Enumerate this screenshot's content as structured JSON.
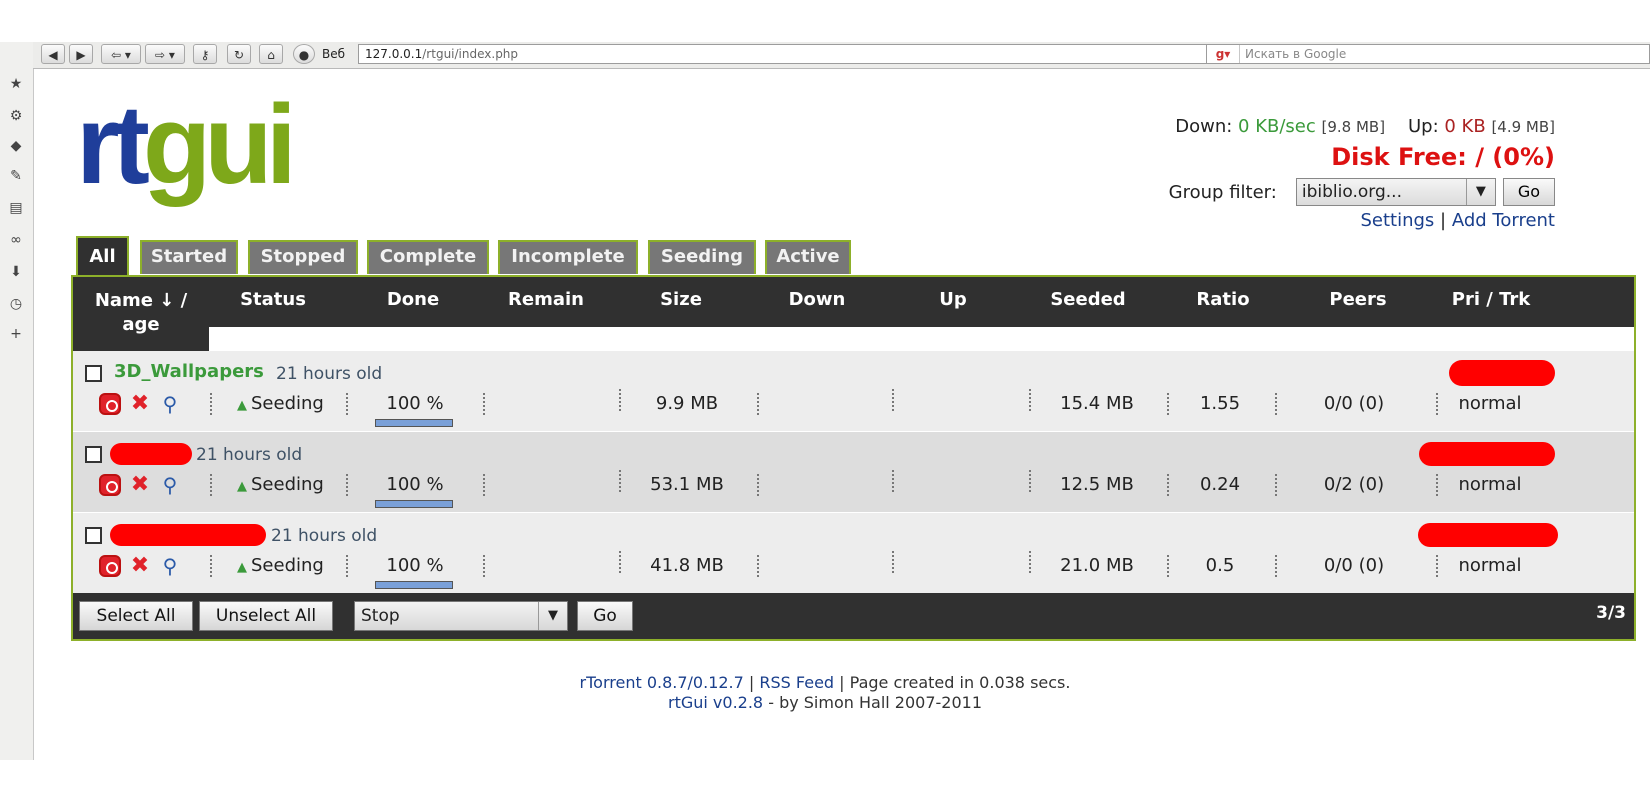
{
  "browser": {
    "web_label": "Веб",
    "url_host": "127.0.0.1",
    "url_path": "/rtgui/index.php",
    "search_placeholder": "Искать в Google"
  },
  "logo": {
    "part1": "rt",
    "part2": "gui"
  },
  "header": {
    "down_label": "Down:",
    "down_rate": "0 KB/sec",
    "down_total": "[9.8 MB]",
    "up_label": "Up:",
    "up_rate": "0 KB",
    "up_total": "[4.9 MB]",
    "disk_free": "Disk Free: / (0%)",
    "group_filter_label": "Group filter:",
    "group_filter_value": "ibiblio.org...",
    "go_label": "Go",
    "settings_label": "Settings",
    "separator": "|",
    "add_torrent_label": "Add Torrent"
  },
  "tabs": [
    "All",
    "Started",
    "Stopped",
    "Complete",
    "Incomplete",
    "Seeding",
    "Active"
  ],
  "columns": {
    "name": "Name ↓ /",
    "name2": "age",
    "status": "Status",
    "done": "Done",
    "remain": "Remain",
    "size": "Size",
    "down": "Down",
    "up": "Up",
    "seeded": "Seeded",
    "ratio": "Ratio",
    "peers": "Peers",
    "pri_trk": "Pri / Trk"
  },
  "torrents": [
    {
      "name": "3D_Wallpapers",
      "age": "21 hours old",
      "status": "Seeding",
      "done": "100 %",
      "done_fraction": 1.0,
      "size": "9.9 MB",
      "seeded": "15.4 MB",
      "ratio": "1.55",
      "peers": "0/0 (0)",
      "priority": "normal"
    },
    {
      "name": "",
      "age": "21 hours old",
      "status": "Seeding",
      "done": "100 %",
      "done_fraction": 1.0,
      "size": "53.1 MB",
      "seeded": "12.5 MB",
      "ratio": "0.24",
      "peers": "0/2 (0)",
      "priority": "normal"
    },
    {
      "name": "",
      "age": "21 hours old",
      "status": "Seeding",
      "done": "100 %",
      "done_fraction": 1.0,
      "size": "41.8 MB",
      "seeded": "21.0 MB",
      "ratio": "0.5",
      "peers": "0/0 (0)",
      "priority": "normal"
    }
  ],
  "footer_bar": {
    "select_all": "Select All",
    "unselect_all": "Unselect All",
    "action_value": "Stop",
    "go_label": "Go",
    "count": "3/3"
  },
  "footer": {
    "rtorrent_version": "rTorrent 0.8.7/0.12.7",
    "sep": "|",
    "rss_feed": "RSS Feed",
    "page_created": "| Page created in 0.038 secs.",
    "rtgui_version": "rtGui v0.2.8",
    "by": "- by Simon Hall 2007-2011"
  },
  "colors": {
    "accent_green": "#8db02a",
    "logo_blue": "#1f3e9a",
    "logo_green": "#7ea81a",
    "disk_red": "#dd1111"
  }
}
